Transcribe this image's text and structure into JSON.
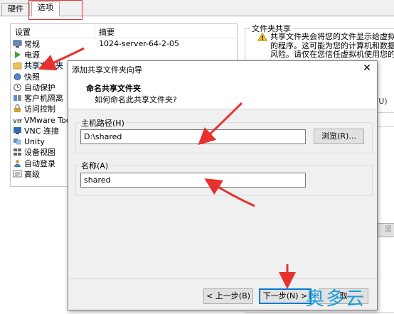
{
  "tabs": [
    {
      "label": "硬件"
    },
    {
      "label": "选项"
    }
  ],
  "settings": {
    "header_setting": "设置",
    "header_summary": "摘要",
    "summary_value": "1024-server-64-2-05",
    "items": [
      {
        "label": "常规",
        "icon": "monitor-icon"
      },
      {
        "label": "电源",
        "icon": "play-icon"
      },
      {
        "label": "共享文件夹",
        "icon": "folder-icon"
      },
      {
        "label": "快照",
        "icon": "snapshot-icon"
      },
      {
        "label": "自动保护",
        "icon": "clock-icon"
      },
      {
        "label": "客户机隔离",
        "icon": "isolation-icon"
      },
      {
        "label": "访问控制",
        "icon": "access-icon"
      },
      {
        "label": "VMware Too",
        "icon": "vmware-icon"
      },
      {
        "label": "VNC 连接",
        "icon": "vnc-icon"
      },
      {
        "label": "Unity",
        "icon": "unity-icon"
      },
      {
        "label": "设备视图",
        "icon": "device-icon"
      },
      {
        "label": "自动登录",
        "icon": "user-icon"
      },
      {
        "label": "高级",
        "icon": "advanced-icon"
      }
    ]
  },
  "shared_folders": {
    "title": "文件夹共享",
    "warning_lines": [
      "共享文件夹会将您的文件显示给虚拟机",
      "的程序。这可能为您的计算机和数据带",
      "风险。请仅在您信任虚拟机使用您的数"
    ],
    "partial_label": "(U)",
    "partial_button": "属"
  },
  "dialog": {
    "title": "添加共享文件夹向导",
    "close_glyph": "✕",
    "heading": "命名共享文件夹",
    "subheading": "如何命名此共享文件夹?",
    "host_path_label": "主机路径(H)",
    "host_path_value": "D:\\shared",
    "browse_label": "浏览(R)...",
    "name_label": "名称(A)",
    "name_value": "shared",
    "back_label": "< 上一步(B)",
    "next_label": "下一步(N) >",
    "cancel_partial": "取"
  },
  "watermark": "奥多云",
  "colors": {
    "annotation": "#e8302e",
    "accent": "#0078d7",
    "watermark": "#1d9bd8"
  }
}
